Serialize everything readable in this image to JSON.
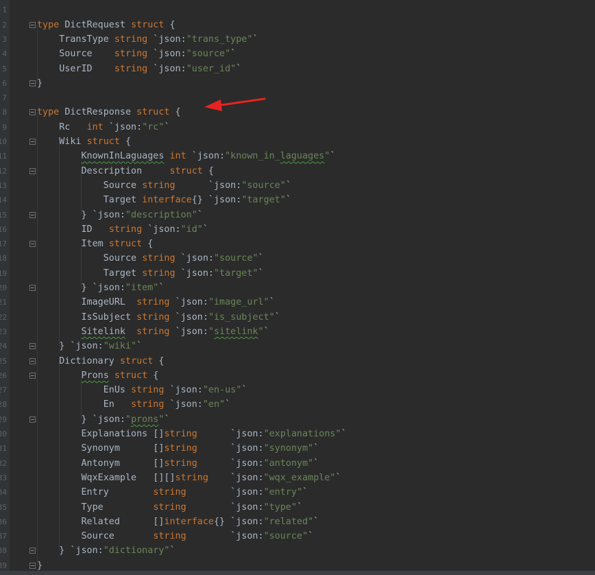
{
  "lines": [
    {
      "n": "1",
      "tokens": []
    },
    {
      "n": "2",
      "fold": "open",
      "tokens": [
        {
          "t": "type ",
          "c": "kw"
        },
        {
          "t": "DictRequest ",
          "c": "plain"
        },
        {
          "t": "struct",
          "c": "kw"
        },
        {
          "t": " {",
          "c": "plain"
        }
      ]
    },
    {
      "n": "3",
      "tokens": [
        {
          "t": "    TransType ",
          "c": "plain"
        },
        {
          "t": "string",
          "c": "kw"
        },
        {
          "t": " `json:",
          "c": "plain"
        },
        {
          "t": "\"trans_type\"",
          "c": "str"
        },
        {
          "t": "`",
          "c": "plain"
        }
      ]
    },
    {
      "n": "4",
      "tokens": [
        {
          "t": "    Source    ",
          "c": "plain"
        },
        {
          "t": "string",
          "c": "kw"
        },
        {
          "t": " `json:",
          "c": "plain"
        },
        {
          "t": "\"source\"",
          "c": "str"
        },
        {
          "t": "`",
          "c": "plain"
        }
      ]
    },
    {
      "n": "5",
      "tokens": [
        {
          "t": "    UserID    ",
          "c": "plain"
        },
        {
          "t": "string",
          "c": "kw"
        },
        {
          "t": " `json:",
          "c": "plain"
        },
        {
          "t": "\"user_id\"",
          "c": "str"
        },
        {
          "t": "`",
          "c": "plain"
        }
      ]
    },
    {
      "n": "6",
      "fold": "close",
      "tokens": [
        {
          "t": "}",
          "c": "plain"
        }
      ]
    },
    {
      "n": "7",
      "tokens": []
    },
    {
      "n": "8",
      "fold": "open",
      "tokens": [
        {
          "t": "type ",
          "c": "kw"
        },
        {
          "t": "DictResponse ",
          "c": "plain"
        },
        {
          "t": "struct",
          "c": "kw"
        },
        {
          "t": " {",
          "c": "plain"
        }
      ]
    },
    {
      "n": "9",
      "tokens": [
        {
          "t": "    Rc   ",
          "c": "plain"
        },
        {
          "t": "int",
          "c": "kw"
        },
        {
          "t": " `json:",
          "c": "plain"
        },
        {
          "t": "\"rc\"",
          "c": "str"
        },
        {
          "t": "`",
          "c": "plain"
        }
      ]
    },
    {
      "n": "10",
      "fold": "open",
      "tokens": [
        {
          "t": "    Wiki ",
          "c": "plain"
        },
        {
          "t": "struct",
          "c": "kw"
        },
        {
          "t": " {",
          "c": "plain"
        }
      ]
    },
    {
      "n": "11",
      "tokens": [
        {
          "t": "        ",
          "c": "plain"
        },
        {
          "t": "KnownInLaguages",
          "c": "plain",
          "sq": true
        },
        {
          "t": " ",
          "c": "plain"
        },
        {
          "t": "int",
          "c": "kw"
        },
        {
          "t": " `json:",
          "c": "plain"
        },
        {
          "t": "\"known_in_",
          "c": "str"
        },
        {
          "t": "laguages",
          "c": "str",
          "sq": true
        },
        {
          "t": "\"",
          "c": "str"
        },
        {
          "t": "`",
          "c": "plain"
        }
      ]
    },
    {
      "n": "12",
      "fold": "open",
      "tokens": [
        {
          "t": "        Description     ",
          "c": "plain"
        },
        {
          "t": "struct",
          "c": "kw"
        },
        {
          "t": " {",
          "c": "plain"
        }
      ]
    },
    {
      "n": "13",
      "tokens": [
        {
          "t": "            Source ",
          "c": "plain"
        },
        {
          "t": "string",
          "c": "kw"
        },
        {
          "t": "      `json:",
          "c": "plain"
        },
        {
          "t": "\"source\"",
          "c": "str"
        },
        {
          "t": "`",
          "c": "plain"
        }
      ]
    },
    {
      "n": "14",
      "tokens": [
        {
          "t": "            Target ",
          "c": "plain"
        },
        {
          "t": "interface",
          "c": "kw"
        },
        {
          "t": "{} `json:",
          "c": "plain"
        },
        {
          "t": "\"target\"",
          "c": "str"
        },
        {
          "t": "`",
          "c": "plain"
        }
      ]
    },
    {
      "n": "15",
      "fold": "close",
      "tokens": [
        {
          "t": "        } `json:",
          "c": "plain"
        },
        {
          "t": "\"description\"",
          "c": "str"
        },
        {
          "t": "`",
          "c": "plain"
        }
      ]
    },
    {
      "n": "16",
      "tokens": [
        {
          "t": "        ID   ",
          "c": "plain"
        },
        {
          "t": "string",
          "c": "kw"
        },
        {
          "t": " `json:",
          "c": "plain"
        },
        {
          "t": "\"id\"",
          "c": "str"
        },
        {
          "t": "`",
          "c": "plain"
        }
      ]
    },
    {
      "n": "17",
      "fold": "open",
      "tokens": [
        {
          "t": "        Item ",
          "c": "plain"
        },
        {
          "t": "struct",
          "c": "kw"
        },
        {
          "t": " {",
          "c": "plain"
        }
      ]
    },
    {
      "n": "18",
      "tokens": [
        {
          "t": "            Source ",
          "c": "plain"
        },
        {
          "t": "string",
          "c": "kw"
        },
        {
          "t": " `json:",
          "c": "plain"
        },
        {
          "t": "\"source\"",
          "c": "str"
        },
        {
          "t": "`",
          "c": "plain"
        }
      ]
    },
    {
      "n": "19",
      "tokens": [
        {
          "t": "            Target ",
          "c": "plain"
        },
        {
          "t": "string",
          "c": "kw"
        },
        {
          "t": " `json:",
          "c": "plain"
        },
        {
          "t": "\"target\"",
          "c": "str"
        },
        {
          "t": "`",
          "c": "plain"
        }
      ]
    },
    {
      "n": "20",
      "fold": "close",
      "tokens": [
        {
          "t": "        } `json:",
          "c": "plain"
        },
        {
          "t": "\"item\"",
          "c": "str"
        },
        {
          "t": "`",
          "c": "plain"
        }
      ]
    },
    {
      "n": "21",
      "tokens": [
        {
          "t": "        ImageURL  ",
          "c": "plain"
        },
        {
          "t": "string",
          "c": "kw"
        },
        {
          "t": " `json:",
          "c": "plain"
        },
        {
          "t": "\"image_url\"",
          "c": "str"
        },
        {
          "t": "`",
          "c": "plain"
        }
      ]
    },
    {
      "n": "22",
      "tokens": [
        {
          "t": "        IsSubject ",
          "c": "plain"
        },
        {
          "t": "string",
          "c": "kw"
        },
        {
          "t": " `json:",
          "c": "plain"
        },
        {
          "t": "\"is_subject\"",
          "c": "str"
        },
        {
          "t": "`",
          "c": "plain"
        }
      ]
    },
    {
      "n": "23",
      "tokens": [
        {
          "t": "        ",
          "c": "plain"
        },
        {
          "t": "Sitelink",
          "c": "plain",
          "sq": true
        },
        {
          "t": "  ",
          "c": "plain"
        },
        {
          "t": "string",
          "c": "kw"
        },
        {
          "t": " `json:",
          "c": "plain"
        },
        {
          "t": "\"",
          "c": "str"
        },
        {
          "t": "sitelink",
          "c": "str",
          "sq": true
        },
        {
          "t": "\"",
          "c": "str"
        },
        {
          "t": "`",
          "c": "plain"
        }
      ]
    },
    {
      "n": "24",
      "fold": "close",
      "tokens": [
        {
          "t": "    } `json:",
          "c": "plain"
        },
        {
          "t": "\"wiki\"",
          "c": "str"
        },
        {
          "t": "`",
          "c": "plain"
        }
      ]
    },
    {
      "n": "25",
      "fold": "open",
      "tokens": [
        {
          "t": "    Dictionary ",
          "c": "plain"
        },
        {
          "t": "struct",
          "c": "kw"
        },
        {
          "t": " {",
          "c": "plain"
        }
      ]
    },
    {
      "n": "26",
      "fold": "open",
      "tokens": [
        {
          "t": "        ",
          "c": "plain"
        },
        {
          "t": "Prons",
          "c": "plain",
          "sq": true
        },
        {
          "t": " ",
          "c": "plain"
        },
        {
          "t": "struct",
          "c": "kw"
        },
        {
          "t": " {",
          "c": "plain"
        }
      ]
    },
    {
      "n": "27",
      "tokens": [
        {
          "t": "            EnUs ",
          "c": "plain"
        },
        {
          "t": "string",
          "c": "kw"
        },
        {
          "t": " `json:",
          "c": "plain"
        },
        {
          "t": "\"en-us\"",
          "c": "str"
        },
        {
          "t": "`",
          "c": "plain"
        }
      ]
    },
    {
      "n": "28",
      "tokens": [
        {
          "t": "            En   ",
          "c": "plain"
        },
        {
          "t": "string",
          "c": "kw"
        },
        {
          "t": " `json:",
          "c": "plain"
        },
        {
          "t": "\"en\"",
          "c": "str"
        },
        {
          "t": "`",
          "c": "plain"
        }
      ]
    },
    {
      "n": "29",
      "fold": "close",
      "tokens": [
        {
          "t": "        } `json:",
          "c": "plain"
        },
        {
          "t": "\"",
          "c": "str"
        },
        {
          "t": "prons",
          "c": "str",
          "sq": true
        },
        {
          "t": "\"",
          "c": "str"
        },
        {
          "t": "`",
          "c": "plain"
        }
      ]
    },
    {
      "n": "30",
      "tokens": [
        {
          "t": "        Explanations []",
          "c": "plain"
        },
        {
          "t": "string",
          "c": "kw"
        },
        {
          "t": "      `json:",
          "c": "plain"
        },
        {
          "t": "\"explanations\"",
          "c": "str"
        },
        {
          "t": "`",
          "c": "plain"
        }
      ]
    },
    {
      "n": "31",
      "tokens": [
        {
          "t": "        Synonym      []",
          "c": "plain"
        },
        {
          "t": "string",
          "c": "kw"
        },
        {
          "t": "      `json:",
          "c": "plain"
        },
        {
          "t": "\"synonym\"",
          "c": "str"
        },
        {
          "t": "`",
          "c": "plain"
        }
      ]
    },
    {
      "n": "32",
      "tokens": [
        {
          "t": "        Antonym      []",
          "c": "plain"
        },
        {
          "t": "string",
          "c": "kw"
        },
        {
          "t": "      `json:",
          "c": "plain"
        },
        {
          "t": "\"antonym\"",
          "c": "str"
        },
        {
          "t": "`",
          "c": "plain"
        }
      ]
    },
    {
      "n": "33",
      "tokens": [
        {
          "t": "        WqxExample   [][]",
          "c": "plain"
        },
        {
          "t": "string",
          "c": "kw"
        },
        {
          "t": "    `json:",
          "c": "plain"
        },
        {
          "t": "\"wqx_example\"",
          "c": "str"
        },
        {
          "t": "`",
          "c": "plain"
        }
      ]
    },
    {
      "n": "34",
      "tokens": [
        {
          "t": "        Entry        ",
          "c": "plain"
        },
        {
          "t": "string",
          "c": "kw"
        },
        {
          "t": "        `json:",
          "c": "plain"
        },
        {
          "t": "\"entry\"",
          "c": "str"
        },
        {
          "t": "`",
          "c": "plain"
        }
      ]
    },
    {
      "n": "35",
      "tokens": [
        {
          "t": "        Type         ",
          "c": "plain"
        },
        {
          "t": "string",
          "c": "kw"
        },
        {
          "t": "        `json:",
          "c": "plain"
        },
        {
          "t": "\"type\"",
          "c": "str"
        },
        {
          "t": "`",
          "c": "plain"
        }
      ]
    },
    {
      "n": "36",
      "tokens": [
        {
          "t": "        Related      []",
          "c": "plain"
        },
        {
          "t": "interface",
          "c": "kw"
        },
        {
          "t": "{} `json:",
          "c": "plain"
        },
        {
          "t": "\"related\"",
          "c": "str"
        },
        {
          "t": "`",
          "c": "plain"
        }
      ]
    },
    {
      "n": "37",
      "tokens": [
        {
          "t": "        Source       ",
          "c": "plain"
        },
        {
          "t": "string",
          "c": "kw"
        },
        {
          "t": "        `json:",
          "c": "plain"
        },
        {
          "t": "\"source\"",
          "c": "str"
        },
        {
          "t": "`",
          "c": "plain"
        }
      ]
    },
    {
      "n": "38",
      "fold": "close",
      "tokens": [
        {
          "t": "    } `json:",
          "c": "plain"
        },
        {
          "t": "\"dictionary\"",
          "c": "str"
        },
        {
          "t": "`",
          "c": "plain"
        }
      ]
    },
    {
      "n": "39",
      "fold": "close",
      "tokens": [
        {
          "t": "}",
          "c": "plain"
        }
      ]
    }
  ],
  "colors": {
    "background": "#2b2b2b",
    "keyword": "#cc7832",
    "string": "#6a8759",
    "text": "#a9b7c6",
    "annotation_arrow": "#e8231f"
  },
  "icons": {
    "fold_open": "fold-open-icon",
    "fold_close": "fold-close-icon"
  }
}
